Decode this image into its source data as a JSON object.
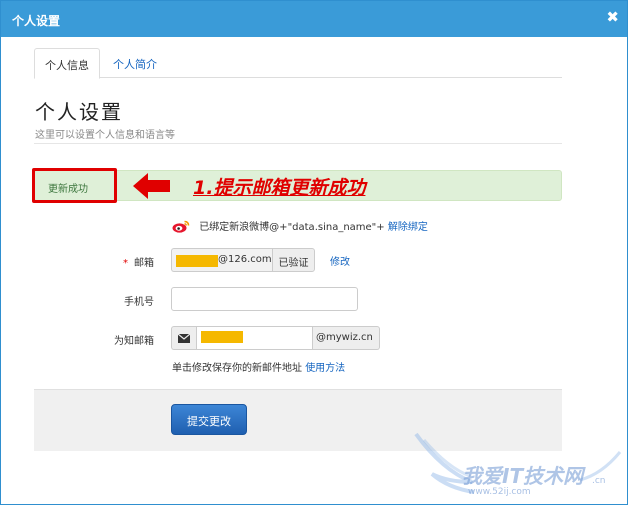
{
  "dialog": {
    "title": "个人设置",
    "close_glyph": "✖"
  },
  "tabs": [
    {
      "label": "个人信息",
      "active": true
    },
    {
      "label": "个人简介",
      "active": false
    }
  ],
  "page": {
    "heading": "个人设置",
    "subheading": "这里可以设置个人信息和语言等"
  },
  "alert": {
    "text": "更新成功",
    "annotation": "1.提示邮箱更新成功"
  },
  "weibo": {
    "icon": "weibo-icon",
    "bound_text": "已绑定新浪微博@+\"data.sina_name\"+",
    "unbind_label": "解除绑定"
  },
  "form": {
    "email": {
      "required_mark": "*",
      "label": "邮箱",
      "value_suffix": "@126.com",
      "verified_label": "已验证",
      "modify_label": "修改"
    },
    "phone": {
      "label": "手机号",
      "value": ""
    },
    "notify_email": {
      "label": "为知邮箱",
      "icon": "envelope-icon",
      "suffix": "@mywiz.cn"
    },
    "help": {
      "text": "单击修改保存你的新邮件地址",
      "link_label": "使用方法"
    },
    "submit_label": "提交更改"
  },
  "watermark": {
    "text": "我爱IT技术网",
    "url": "www.52ij.com",
    "cn": ".cn"
  },
  "colors": {
    "titlebar": "#3a9bd8",
    "link": "#1565c0",
    "alert_bg": "#dff0d8",
    "alert_text": "#3c763d",
    "annotation": "#e00000",
    "highlight": "#f5b800",
    "submit": "#1f5fb0"
  }
}
